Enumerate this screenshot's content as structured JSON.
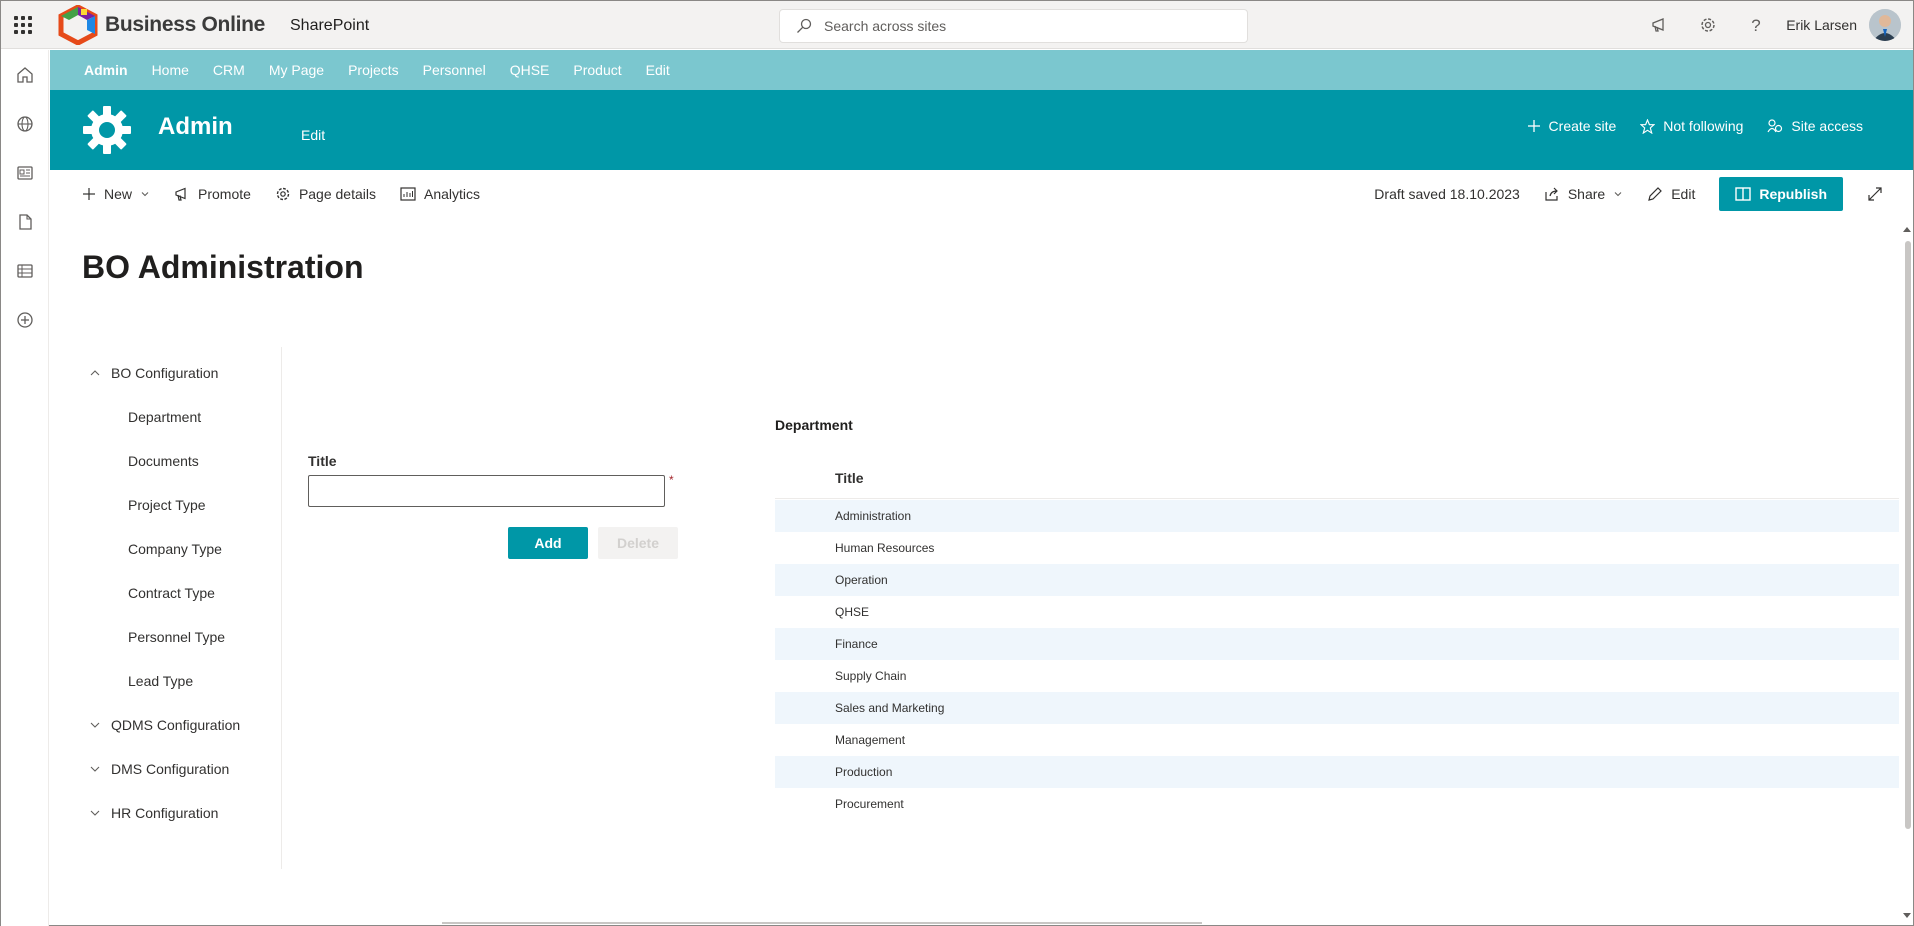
{
  "suite": {
    "brand_name": "Business Online",
    "app_label": "SharePoint",
    "search_placeholder": "Search across sites",
    "user_name": "Erik Larsen"
  },
  "hub_nav": {
    "items": [
      {
        "label": "Admin",
        "active": true
      },
      {
        "label": "Home"
      },
      {
        "label": "CRM"
      },
      {
        "label": "My Page"
      },
      {
        "label": "Projects"
      },
      {
        "label": "Personnel"
      },
      {
        "label": "QHSE"
      },
      {
        "label": "Product"
      },
      {
        "label": "Edit"
      }
    ]
  },
  "site_header": {
    "title": "Admin",
    "edit_label": "Edit",
    "actions": [
      "Create site",
      "Not following",
      "Site access"
    ]
  },
  "command_bar": {
    "new_label": "New",
    "promote_label": "Promote",
    "page_details_label": "Page details",
    "analytics_label": "Analytics",
    "draft_status": "Draft saved 18.10.2023",
    "share_label": "Share",
    "edit_label": "Edit",
    "republish_label": "Republish"
  },
  "page": {
    "title": "BO Administration"
  },
  "tree_nav": {
    "groups": [
      {
        "label": "BO Configuration",
        "expanded": true,
        "items": [
          "Department",
          "Documents",
          "Project Type",
          "Company Type",
          "Contract Type",
          "Personnel Type",
          "Lead Type"
        ]
      },
      {
        "label": "QDMS Configuration",
        "expanded": false
      },
      {
        "label": "DMS Configuration",
        "expanded": false
      },
      {
        "label": "HR Configuration",
        "expanded": false
      }
    ]
  },
  "form": {
    "title_label": "Title",
    "title_value": "",
    "required_mark": "*",
    "add_label": "Add",
    "delete_label": "Delete"
  },
  "list": {
    "title": "Department",
    "column_header": "Title",
    "rows": [
      "Administration",
      "Human Resources",
      "Operation",
      "QHSE",
      "Finance",
      "Supply Chain",
      "Sales and Marketing",
      "Management",
      "Production",
      "Procurement"
    ]
  },
  "colors": {
    "accent": "#0097a7",
    "hub_nav": "#7bc7cf",
    "row_alt": "#eff6fc"
  }
}
